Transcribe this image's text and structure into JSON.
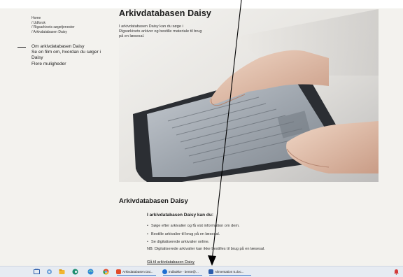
{
  "breadcrumb": {
    "items": [
      "Home",
      "/ Udforsk",
      "/ Rigsarkivets søgetjenester",
      "/ Arkivdatabasen Daisy"
    ]
  },
  "sidebar": {
    "items": [
      {
        "label": "Om arkivdatabasen Daisy",
        "active": true
      },
      {
        "label": "Se en film om, hvordan du søger i Daisy"
      },
      {
        "label": "Flere muligheder"
      }
    ]
  },
  "page": {
    "title": "Arkivdatabasen Daisy",
    "intro": "I arkivdatabasen Daisy kan du søge i Rigsarkivets arkiver og bestille materiale til brug på en læsesal."
  },
  "hero": {
    "icon": "tablet-hands-photo"
  },
  "section": {
    "title": "Arkivdatabasen Daisy",
    "subtitle": "I arkivdatabasen Daisy kan du:",
    "bullets": [
      "Søge efter arkivalier og få vist information om dem.",
      "Bestille arkivalier til brug på en læsesal.",
      "Se digitaliserede arkivalier online."
    ],
    "note": "NB: Digitaliserede arkivalier kan ikke bestilles til brug på en læsesal.",
    "link": "Gå til arkivdatabasen Daisy"
  },
  "taskbar": {
    "apps": [
      {
        "label": "Arkivdatabasen Dai...",
        "color": "#e24a2a"
      },
      {
        "label": "Indbakke - bente@...",
        "color": "#1f6fd1"
      },
      {
        "label": "Alimentation 5.doc...",
        "color": "#2b5cab"
      }
    ],
    "colors": {
      "explorer": "#f2b62f",
      "edge": "#1d8f6f",
      "chrome": "#e24a2a",
      "outlook": "#1f6fd1",
      "word": "#2b5cab",
      "teams": "#5b5fc7",
      "notification": "#d33b3b"
    }
  },
  "annotation": {
    "icon": "arrow-pointer",
    "color": "#000000"
  }
}
